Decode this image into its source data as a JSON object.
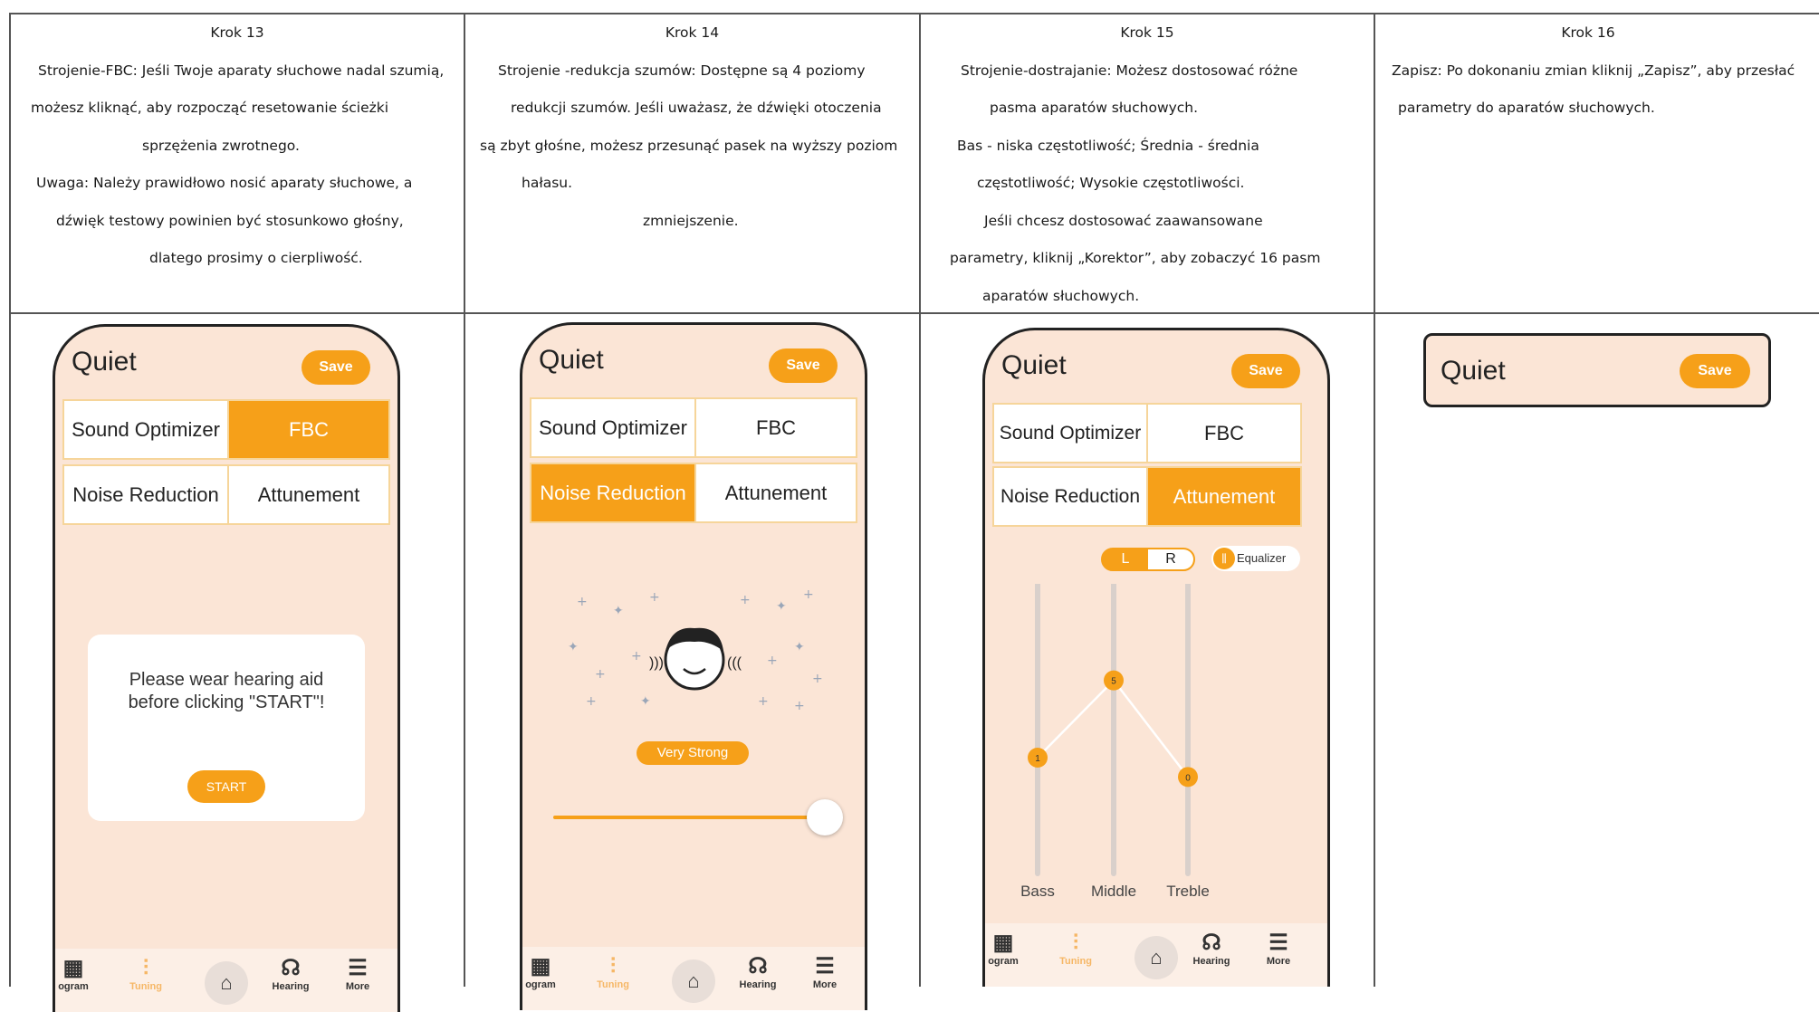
{
  "steps": [
    {
      "title": "Krok 13",
      "lines": [
        "Strojenie-FBC: Jeśli Twoje aparaty słuchowe nadal szumią,",
        "możesz kliknąć, aby rozpocząć resetowanie ścieżki",
        "sprzężenia zwrotnego.",
        "Uwaga: Należy prawidłowo nosić aparaty słuchowe, a",
        "dźwięk testowy powinien być stosunkowo głośny,",
        "dlatego prosimy o cierpliwość."
      ]
    },
    {
      "title": "Krok 14",
      "lines": [
        "Strojenie -redukcja szumów: Dostępne są 4 poziomy",
        "redukcji szumów. Jeśli uważasz, że dźwięki otoczenia",
        "są zbyt głośne, możesz przesunąć pasek na wyższy poziom",
        "hałasu.",
        "zmniejszenie."
      ]
    },
    {
      "title": "Krok 15",
      "lines": [
        "Strojenie-dostrajanie: Możesz dostosować różne",
        "pasma aparatów słuchowych.",
        "Bas - niska częstotliwość; Średnia - średnia",
        "częstotliwość; Wysokie częstotliwości.",
        "Jeśli chcesz dostosować zaawansowane",
        "parametry, kliknij „Korektor”, aby zobaczyć 16 pasm",
        "aparatów słuchowych."
      ]
    },
    {
      "title": "Krok 16",
      "lines": [
        "Zapisz: Po dokonaniu zmian kliknij „Zapisz”, aby przesłać",
        "parametry do aparatów słuchowych."
      ]
    }
  ],
  "app": {
    "program_name": "Quiet",
    "save_label": "Save",
    "tabs": {
      "sound_optimizer": "Sound Optimizer",
      "fbc": "FBC",
      "noise_reduction": "Noise Reduction",
      "attunement": "Attunement"
    },
    "nav": {
      "program": "ogram",
      "tuning": "Tuning",
      "hearing": "Hearing",
      "more": "More"
    },
    "fbc_dialog": {
      "message": "Please wear hearing aid before clicking \"START\"!",
      "start_label": "START"
    },
    "noise": {
      "level_label": "Very Strong",
      "level_fraction": 1.0
    },
    "eq": {
      "left": "L",
      "right": "R",
      "equalizer_label": "Equalizer",
      "bands": [
        {
          "name": "Bass",
          "value": 1
        },
        {
          "name": "Middle",
          "value": 5
        },
        {
          "name": "Treble",
          "value": 0
        }
      ],
      "range": [
        -5,
        10
      ]
    }
  },
  "colors": {
    "accent": "#f6a019",
    "screen_bg": "#fbe5d6",
    "border": "#555555"
  }
}
